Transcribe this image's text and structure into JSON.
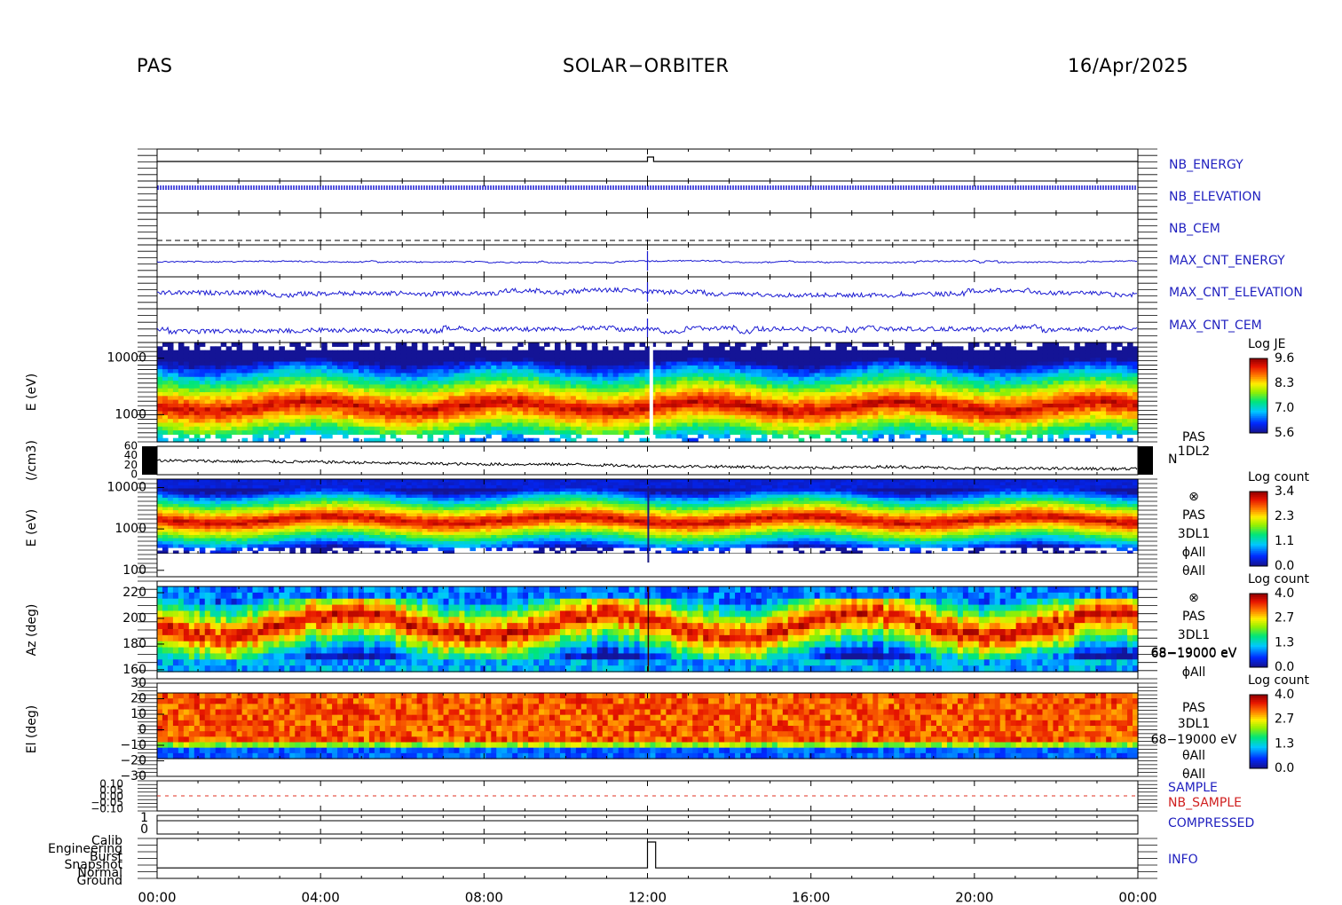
{
  "header": {
    "instrument": "PAS",
    "mission": "SOLAR−ORBITER",
    "date": "16/Apr/2025"
  },
  "colors": {
    "axis": "#000000",
    "trace_blue": "#1a1ad2",
    "trace_red": "#e03020",
    "label_blue": "#1f1fbf",
    "label_red": "#d02020"
  },
  "colormap": "rainbow (blue-cyan-green-yellow-red-darkred)",
  "chart_data": {
    "type": "heatmap",
    "time_axis": {
      "range_hours": [
        0,
        24
      ],
      "tick_hours": [
        0,
        4,
        8,
        12,
        16,
        20,
        24
      ],
      "tick_labels": [
        "00:00",
        "04:00",
        "08:00",
        "12:00",
        "16:00",
        "20:00",
        "00:00"
      ]
    },
    "housekeeping": [
      {
        "label": "NB_ENERGY",
        "color": "blue",
        "series": [
          {
            "t": 0,
            "v": 0
          },
          {
            "t": 12.0,
            "v": 0
          },
          {
            "t": 12.0,
            "v": 1
          },
          {
            "t": 12.15,
            "v": 1
          },
          {
            "t": 12.15,
            "v": 0
          },
          {
            "t": 24,
            "v": 0
          }
        ]
      },
      {
        "label": "NB_ELEVATION",
        "color": "blue",
        "pattern": "dense oscillation"
      },
      {
        "label": "NB_CEM",
        "color": "blue",
        "pattern": "dashed constant"
      },
      {
        "label": "MAX_CNT_ENERGY",
        "color": "blue",
        "pattern": "noisy flat"
      },
      {
        "label": "MAX_CNT_ELEVATION",
        "color": "blue",
        "pattern": "noisy steps"
      },
      {
        "label": "MAX_CNT_CEM",
        "color": "blue",
        "pattern": "noisy steps"
      }
    ],
    "spectrogram_1dl2": {
      "ylabel": "E (eV)",
      "yscale": "log",
      "ylim": [
        330,
        19000
      ],
      "y_ticks": [
        1000,
        10000
      ],
      "y_tick_labels": [
        "1000",
        "10000"
      ],
      "peak_energy_eV": 1000,
      "colorbar": {
        "title": "Log JE",
        "ticks": [
          "9.6",
          "8.3",
          "7.0",
          "5.6"
        ],
        "range": [
          5.6,
          9.6
        ]
      },
      "side_labels": [
        "PAS",
        "1DL2"
      ]
    },
    "density": {
      "ylabel": "(/cm3)",
      "ylim": [
        0,
        60
      ],
      "y_ticks": [
        0,
        20,
        40,
        60
      ],
      "y_tick_labels": [
        "0",
        "20",
        "40",
        "60"
      ],
      "side_label": "N",
      "series": [
        {
          "t": 0,
          "v": 30
        },
        {
          "t": 2,
          "v": 28
        },
        {
          "t": 4,
          "v": 27
        },
        {
          "t": 6,
          "v": 24
        },
        {
          "t": 8,
          "v": 22
        },
        {
          "t": 10,
          "v": 22
        },
        {
          "t": 12,
          "v": 18
        },
        {
          "t": 14,
          "v": 17
        },
        {
          "t": 16,
          "v": 14
        },
        {
          "t": 18,
          "v": 17
        },
        {
          "t": 20,
          "v": 13
        },
        {
          "t": 22,
          "v": 13
        },
        {
          "t": 24,
          "v": 12
        }
      ]
    },
    "spectrogram_3dl1_energy": {
      "ylabel": "E (eV)",
      "yscale": "log",
      "ylim": [
        70,
        16000
      ],
      "y_ticks": [
        100,
        1000,
        10000
      ],
      "y_tick_labels": [
        "100",
        "1000",
        "10000"
      ],
      "colorbar": {
        "title": "Log count",
        "ticks": [
          "3.4",
          "2.3",
          "1.1",
          "0.0"
        ],
        "range": [
          0.0,
          3.4
        ]
      },
      "side_labels": [
        "⊗",
        "PAS",
        "3DL1",
        "ϕAll",
        "θAll"
      ]
    },
    "spectrogram_azimuth": {
      "ylabel": "Az (deg)",
      "ylim": [
        153,
        229
      ],
      "y_ticks": [
        160,
        180,
        200,
        220
      ],
      "y_tick_labels": [
        "160",
        "180",
        "200",
        "220"
      ],
      "colorbar": {
        "title": "Log count",
        "ticks": [
          "4.0",
          "2.7",
          "1.3",
          "0.0"
        ],
        "range": [
          0.0,
          4.0
        ]
      },
      "side_labels": [
        "⊗",
        "PAS",
        "3DL1",
        "68−19000 eV",
        "ϕAll"
      ]
    },
    "spectrogram_elevation": {
      "ylabel": "El (deg)",
      "ylim": [
        -30,
        30
      ],
      "y_ticks": [
        -30,
        -20,
        -10,
        0,
        10,
        20,
        30
      ],
      "y_tick_labels": [
        "−30",
        "−20",
        "−10",
        "0",
        "10",
        "20",
        "30"
      ],
      "colorbar": {
        "title": "Log count",
        "ticks": [
          "4.0",
          "2.7",
          "1.3",
          "0.0"
        ],
        "range": [
          0.0,
          4.0
        ]
      },
      "side_labels": [
        "PAS",
        "3DL1",
        "68−19000 eV",
        "θAll"
      ]
    },
    "sample": {
      "y_tick_labels": [
        "0.10",
        "0.05",
        "0.00",
        "−0.05",
        "−0.10"
      ],
      "labels": [
        {
          "text": "SAMPLE",
          "color": "blue"
        },
        {
          "text": "NB_SAMPLE",
          "color": "red"
        }
      ]
    },
    "compressed": {
      "y_tick_labels": [
        "1",
        "0"
      ],
      "label": "COMPRESSED",
      "value": 1
    },
    "info": {
      "categories": [
        "Calib",
        "Engineering",
        "Burst",
        "Snapshot",
        "Normal",
        "Ground"
      ],
      "label": "INFO",
      "series": [
        {
          "t": 0,
          "c": "Normal"
        },
        {
          "t": 12.0,
          "c": "Normal"
        },
        {
          "t": 12.0,
          "c": "Calib"
        },
        {
          "t": 12.2,
          "c": "Calib"
        },
        {
          "t": 12.2,
          "c": "Normal"
        },
        {
          "t": 24,
          "c": "Normal"
        }
      ]
    }
  }
}
